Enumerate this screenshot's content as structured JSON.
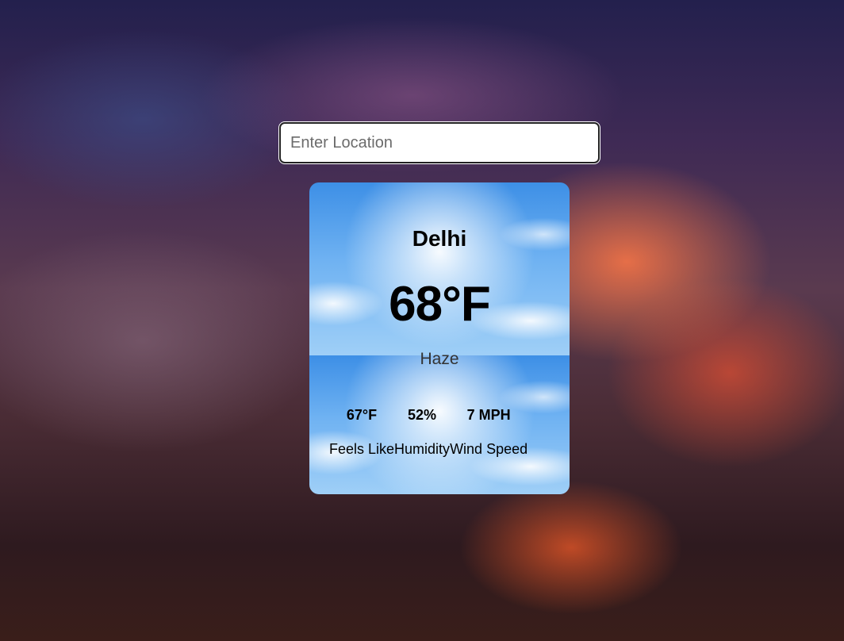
{
  "search": {
    "placeholder": "Enter Location",
    "value": ""
  },
  "weather": {
    "city": "Delhi",
    "temperature": "68°F",
    "condition": "Haze",
    "stats": [
      {
        "value": "67°F",
        "label": "Feels Like"
      },
      {
        "value": "52%",
        "label": "Humidity"
      },
      {
        "value": "7 MPH",
        "label": "Wind Speed"
      }
    ]
  },
  "colors": {
    "card_sky": "#6fb2f2",
    "text": "#000000",
    "condition_text": "#333333"
  }
}
